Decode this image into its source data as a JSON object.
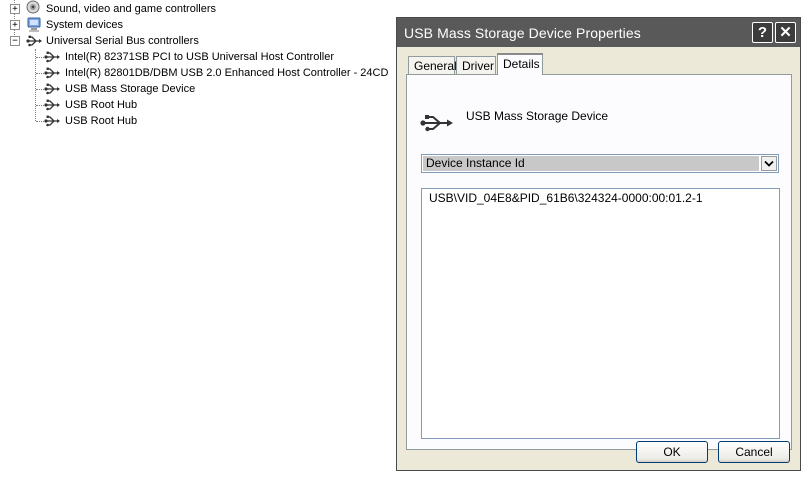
{
  "tree": {
    "items": [
      {
        "label": "Sound, video and game controllers",
        "icon": "speaker-icon",
        "expander": "+"
      },
      {
        "label": "System devices",
        "icon": "computer-icon",
        "expander": "+"
      },
      {
        "label": "Universal Serial Bus controllers",
        "icon": "usb-icon",
        "expander": "−"
      },
      {
        "label": "Intel(R) 82371SB PCI to USB Universal Host Controller",
        "icon": "usb-icon"
      },
      {
        "label": "Intel(R) 82801DB/DBM USB 2.0 Enhanced Host Controller - 24CD",
        "icon": "usb-icon"
      },
      {
        "label": "USB Mass Storage Device",
        "icon": "usb-icon"
      },
      {
        "label": "USB Root Hub",
        "icon": "usb-icon"
      },
      {
        "label": "USB Root Hub",
        "icon": "usb-icon"
      }
    ]
  },
  "dialog": {
    "title": "USB Mass Storage Device Properties",
    "help_glyph": "?",
    "close_glyph": "✕",
    "tabs": [
      {
        "label": "General"
      },
      {
        "label": "Driver"
      },
      {
        "label": "Details",
        "active": true
      }
    ],
    "device_name": "USB Mass Storage Device",
    "property_selected": "Device Instance Id",
    "values": [
      "USB\\VID_04E8&PID_61B6\\324324-0000:00:01.2-1"
    ],
    "ok_label": "OK",
    "cancel_label": "Cancel"
  },
  "colors": {
    "titlebar": "#595959",
    "dialog_bg": "#ece9d8",
    "select_highlight": "#c8c8c8"
  }
}
